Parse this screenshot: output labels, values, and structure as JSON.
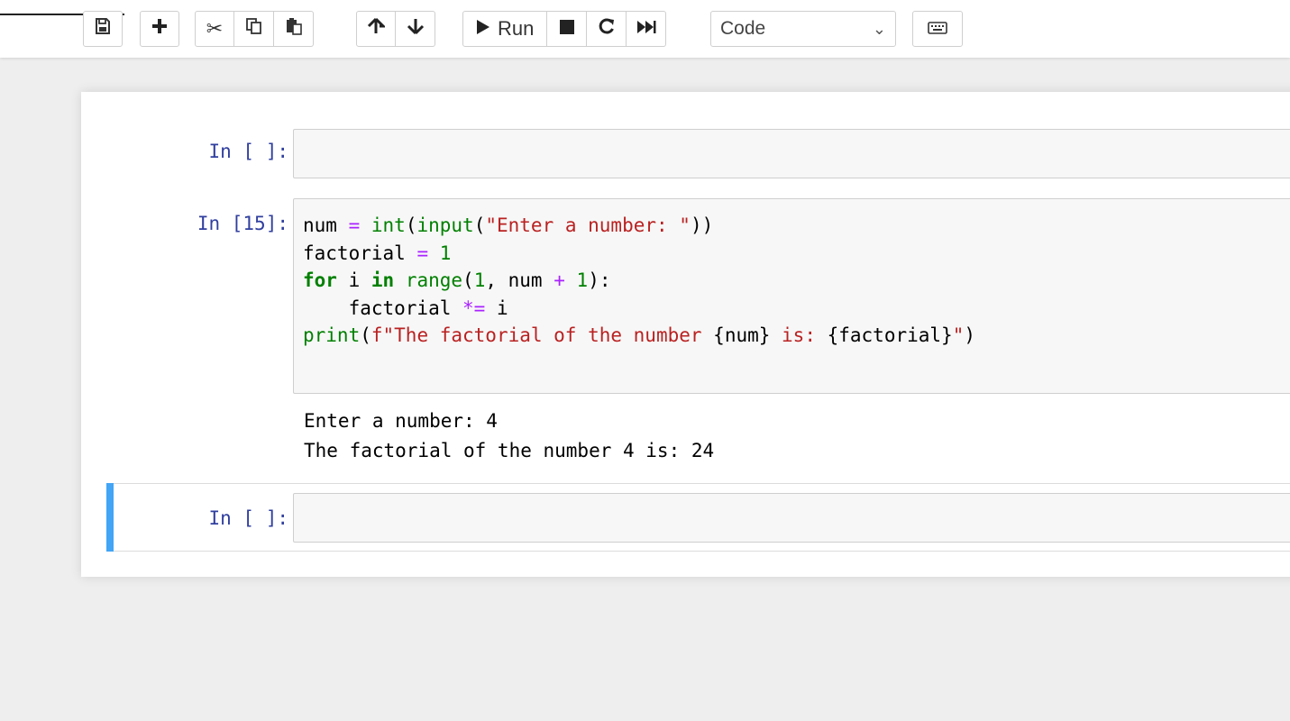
{
  "toolbar": {
    "save_icon": "floppy-disk-icon",
    "insert_icon": "plus-icon",
    "cut_icon": "scissors-icon",
    "copy_icon": "copy-icon",
    "paste_icon": "paste-icon",
    "move_up_icon": "arrow-up-icon",
    "move_down_icon": "arrow-down-icon",
    "run_label": "Run",
    "interrupt_icon": "stop-icon",
    "restart_icon": "restart-icon",
    "run_all_icon": "fast-forward-icon",
    "cell_type": "Code",
    "keyboard_icon": "keyboard-icon"
  },
  "cells": [
    {
      "prompt": "In [ ]:",
      "code": ""
    },
    {
      "prompt": "In [15]:",
      "code_lines": [
        "num = int(input(\"Enter a number: \"))",
        "factorial = 1",
        "for i in range(1, num + 1):",
        "    factorial *= i",
        "print(f\"The factorial of the number {num} is: {factorial}\")"
      ],
      "output_lines": [
        "Enter a number: 4",
        "The factorial of the number 4 is: 24"
      ]
    },
    {
      "prompt": "In [ ]:",
      "code": ""
    }
  ],
  "colors": {
    "prompt": "#303f9f",
    "keyword": "#008000",
    "string": "#ba2121",
    "operator": "#aa22ff",
    "selected_cell_bar": "#42a5f5"
  }
}
